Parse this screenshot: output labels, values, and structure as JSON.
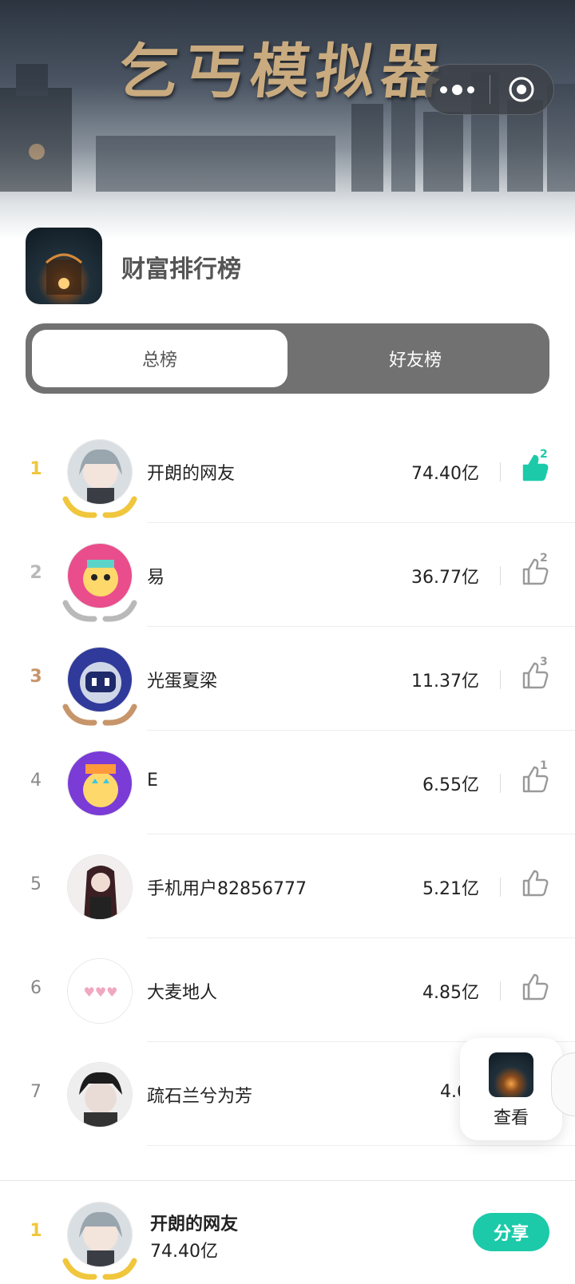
{
  "header": {
    "banner_title": "乞丐模拟器",
    "page_title": "财富排行榜"
  },
  "tabs": [
    {
      "label": "总榜",
      "active": true
    },
    {
      "label": "好友榜",
      "active": false
    }
  ],
  "leaderboard": [
    {
      "rank": "1",
      "name": "开朗的网友",
      "score": "74.40亿",
      "likes": "2",
      "liked": true,
      "rank_color": "#f0c63c"
    },
    {
      "rank": "2",
      "name": "易",
      "score": "36.77亿",
      "likes": "2",
      "liked": false,
      "rank_color": "#b9b9b9"
    },
    {
      "rank": "3",
      "name": "光蛋夏梁",
      "score": "11.37亿",
      "likes": "3",
      "liked": false,
      "rank_color": "#c7956a"
    },
    {
      "rank": "4",
      "name": "E",
      "score": "6.55亿",
      "likes": "1",
      "liked": false,
      "rank_color": "#888888"
    },
    {
      "rank": "5",
      "name": "手机用户82856777",
      "score": "5.21亿",
      "likes": "",
      "liked": false,
      "rank_color": "#888888"
    },
    {
      "rank": "6",
      "name": "大麦地人",
      "score": "4.85亿",
      "likes": "",
      "liked": false,
      "rank_color": "#888888"
    },
    {
      "rank": "7",
      "name": "疏石兰兮为芳",
      "score": "4.63",
      "likes": "",
      "liked": false,
      "rank_color": "#888888"
    }
  ],
  "float_card": {
    "label": "查看"
  },
  "footer": {
    "rank": "1",
    "name": "开朗的网友",
    "score": "74.40亿",
    "share_label": "分享"
  },
  "colors": {
    "accent": "#1ccaa9",
    "gold": "#f0c63c",
    "silver": "#b9b9b9",
    "bronze": "#c7956a",
    "tab_bg": "#717171"
  }
}
